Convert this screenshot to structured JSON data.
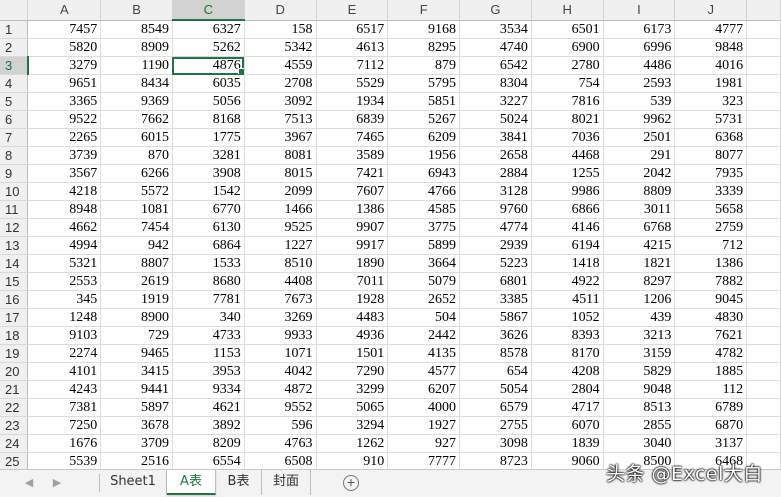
{
  "columns": [
    "A",
    "B",
    "C",
    "D",
    "E",
    "F",
    "G",
    "H",
    "I",
    "J"
  ],
  "selected_cell": {
    "row": "3",
    "col": "C"
  },
  "rows": [
    {
      "n": "1",
      "cells": [
        "7457",
        "8549",
        "6327",
        "158",
        "6517",
        "9168",
        "3534",
        "6501",
        "6173",
        "4777"
      ]
    },
    {
      "n": "2",
      "cells": [
        "5820",
        "8909",
        "5262",
        "5342",
        "4613",
        "8295",
        "4740",
        "6900",
        "6996",
        "9848"
      ]
    },
    {
      "n": "3",
      "cells": [
        "3279",
        "1190",
        "4876",
        "4559",
        "7112",
        "879",
        "6542",
        "2780",
        "4486",
        "4016"
      ]
    },
    {
      "n": "4",
      "cells": [
        "9651",
        "8434",
        "6035",
        "2708",
        "5529",
        "5795",
        "8304",
        "754",
        "2593",
        "1981"
      ]
    },
    {
      "n": "5",
      "cells": [
        "3365",
        "9369",
        "5056",
        "3092",
        "1934",
        "5851",
        "3227",
        "7816",
        "539",
        "323"
      ]
    },
    {
      "n": "6",
      "cells": [
        "9522",
        "7662",
        "8168",
        "7513",
        "6839",
        "5267",
        "5024",
        "8021",
        "9962",
        "5731"
      ]
    },
    {
      "n": "7",
      "cells": [
        "2265",
        "6015",
        "1775",
        "3967",
        "7465",
        "6209",
        "3841",
        "7036",
        "2501",
        "6368"
      ]
    },
    {
      "n": "8",
      "cells": [
        "3739",
        "870",
        "3281",
        "8081",
        "3589",
        "1956",
        "2658",
        "4468",
        "291",
        "8077"
      ]
    },
    {
      "n": "9",
      "cells": [
        "3567",
        "6266",
        "3908",
        "8015",
        "7421",
        "6943",
        "2884",
        "1255",
        "2042",
        "7935"
      ]
    },
    {
      "n": "10",
      "cells": [
        "4218",
        "5572",
        "1542",
        "2099",
        "7607",
        "4766",
        "3128",
        "9986",
        "8809",
        "3339"
      ]
    },
    {
      "n": "11",
      "cells": [
        "8948",
        "1081",
        "6770",
        "1466",
        "1386",
        "4585",
        "9760",
        "6866",
        "3011",
        "5658"
      ]
    },
    {
      "n": "12",
      "cells": [
        "4662",
        "7454",
        "6130",
        "9525",
        "9907",
        "3775",
        "4774",
        "4146",
        "6768",
        "2759"
      ]
    },
    {
      "n": "13",
      "cells": [
        "4994",
        "942",
        "6864",
        "1227",
        "9917",
        "5899",
        "2939",
        "6194",
        "4215",
        "712"
      ]
    },
    {
      "n": "14",
      "cells": [
        "5321",
        "8807",
        "1533",
        "8510",
        "1890",
        "3664",
        "5223",
        "1418",
        "1821",
        "1386"
      ]
    },
    {
      "n": "15",
      "cells": [
        "2553",
        "2619",
        "8680",
        "4408",
        "7011",
        "5079",
        "6801",
        "4922",
        "8297",
        "7882"
      ]
    },
    {
      "n": "16",
      "cells": [
        "345",
        "1919",
        "7781",
        "7673",
        "1928",
        "2652",
        "3385",
        "4511",
        "1206",
        "9045"
      ]
    },
    {
      "n": "17",
      "cells": [
        "1248",
        "8900",
        "340",
        "3269",
        "4483",
        "504",
        "5867",
        "1052",
        "439",
        "4830"
      ]
    },
    {
      "n": "18",
      "cells": [
        "9103",
        "729",
        "4733",
        "9933",
        "4936",
        "2442",
        "3626",
        "8393",
        "3213",
        "7621"
      ]
    },
    {
      "n": "19",
      "cells": [
        "2274",
        "9465",
        "1153",
        "1071",
        "1501",
        "4135",
        "8578",
        "8170",
        "3159",
        "4782"
      ]
    },
    {
      "n": "20",
      "cells": [
        "4101",
        "3415",
        "3953",
        "4042",
        "7290",
        "4577",
        "654",
        "4208",
        "5829",
        "1885"
      ]
    },
    {
      "n": "21",
      "cells": [
        "4243",
        "9441",
        "9334",
        "4872",
        "3299",
        "6207",
        "5054",
        "2804",
        "9048",
        "112"
      ]
    },
    {
      "n": "22",
      "cells": [
        "7381",
        "5897",
        "4621",
        "9552",
        "5065",
        "4000",
        "6579",
        "4717",
        "8513",
        "6789"
      ]
    },
    {
      "n": "23",
      "cells": [
        "7250",
        "3678",
        "3892",
        "596",
        "3294",
        "1927",
        "2755",
        "6070",
        "2855",
        "6870"
      ]
    },
    {
      "n": "24",
      "cells": [
        "1676",
        "3709",
        "8209",
        "4763",
        "1262",
        "927",
        "3098",
        "1839",
        "3040",
        "3137"
      ]
    },
    {
      "n": "25",
      "cells": [
        "5539",
        "2516",
        "6554",
        "6508",
        "910",
        "7777",
        "8723",
        "9060",
        "8500",
        "6468"
      ]
    }
  ],
  "sheet_tabs": [
    {
      "label": "Sheet1",
      "active": false
    },
    {
      "label": "A表",
      "active": true
    },
    {
      "label": "B表",
      "active": false
    },
    {
      "label": "封面",
      "active": false
    }
  ],
  "add_sheet_label": "+",
  "nav_prev_icon": "◀",
  "nav_next_icon": "▶",
  "watermark": "头条 @Excel大白",
  "colors": {
    "accent": "#217346",
    "header_bg": "#f0f0f0",
    "selected_header_bg": "#d2d2d2"
  }
}
